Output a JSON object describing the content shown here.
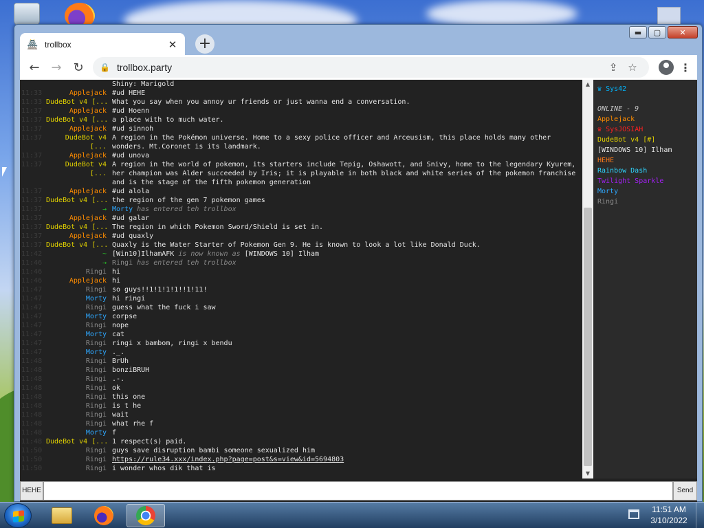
{
  "browser": {
    "tab_title": "trollbox",
    "tab_favicon": "🏯",
    "tab_close": "✕",
    "newtab": "+",
    "url": "trollbox.party",
    "back": "←",
    "forward": "→",
    "reload": "↻",
    "share": "⇪",
    "star": "☆",
    "menu": "⋮",
    "lock": "🔒"
  },
  "window_controls": {
    "minimize": "▬",
    "maximize": "▢",
    "close": "✕"
  },
  "colors": {
    "applejack": "#ff8c00",
    "dudebot": "#e0d000",
    "ringi": "#8a8a8a",
    "morty": "#2ea8ff",
    "system": "#29c429",
    "sys42": "#00b7ff",
    "sysjosiah": "#ff2020",
    "hehe": "#ff7a18",
    "rainbow": "#2ed6ff",
    "twilight": "#a020f0",
    "ilham": "#e6e6e6"
  },
  "chat": {
    "messages": [
      {
        "time": "",
        "nick": "",
        "nick_color": "#8a8a8a",
        "text": "Shiny: Marigold"
      },
      {
        "time": "11:33",
        "nick": "Applejack",
        "nick_color": "#ff8c00",
        "text": "#ud HEHE"
      },
      {
        "time": "11:33",
        "nick": "DudeBot v4 [...",
        "nick_color": "#e0d000",
        "text": "What you say when you annoy ur friends or just wanna end a conversation."
      },
      {
        "time": "11:37",
        "nick": "Applejack",
        "nick_color": "#ff8c00",
        "text": "#ud Hoenn"
      },
      {
        "time": "11:37",
        "nick": "DudeBot v4 [...",
        "nick_color": "#e0d000",
        "text": "a place with to much water."
      },
      {
        "time": "11:37",
        "nick": "Applejack",
        "nick_color": "#ff8c00",
        "text": "#ud sinnoh"
      },
      {
        "time": "11:37",
        "nick": "DudeBot v4 [...",
        "nick_color": "#e0d000",
        "text": "A region in the Pokémon universe. Home to a sexy police officer and Arceusism, this place holds many other wonders. Mt.Coronet is its landmark."
      },
      {
        "time": "11:37",
        "nick": "Applejack",
        "nick_color": "#ff8c00",
        "text": "#ud unova"
      },
      {
        "time": "11:37",
        "nick": "DudeBot v4 [...",
        "nick_color": "#e0d000",
        "text": "A region in the world of pokemon, its starters include Tepig, Oshawott, and Snivy, home to the legendary Kyurem, her champion was Alder succeeded by Iris; it is playable in both black and white series of the pokemon franchise and is the stage of the fifth pokemon generation"
      },
      {
        "time": "11:37",
        "nick": "Applejack",
        "nick_color": "#ff8c00",
        "text": "#ud alola"
      },
      {
        "time": "11:37",
        "nick": "DudeBot v4 [...",
        "nick_color": "#e0d000",
        "text": "the region of the gen 7 pokemon games"
      },
      {
        "time": "11:37",
        "nick": "→",
        "nick_color": "#29c429",
        "text": "",
        "event_user": "Morty",
        "event_user_color": "#2ea8ff",
        "event_text": " has entered teh trollbox"
      },
      {
        "time": "11:37",
        "nick": "Applejack",
        "nick_color": "#ff8c00",
        "text": "#ud galar"
      },
      {
        "time": "11:37",
        "nick": "DudeBot v4 [...",
        "nick_color": "#e0d000",
        "text": "The region in which Pokemon Sword/Shield is set in."
      },
      {
        "time": "11:37",
        "nick": "Applejack",
        "nick_color": "#ff8c00",
        "text": "#ud quaxly"
      },
      {
        "time": "11:37",
        "nick": "DudeBot v4 [...",
        "nick_color": "#e0d000",
        "text": "Quaxly is the Water Starter of Pokemon Gen 9. He is known to look a lot like Donald Duck."
      },
      {
        "time": "11:42",
        "nick": "~",
        "nick_color": "#29c429",
        "text": "",
        "event_user": "[Win10]IlhamAFK",
        "event_user_color": "#e6e6e6",
        "event_text": " is now known as ",
        "event_tail": "[WINDOWS 10] Ilham"
      },
      {
        "time": "11:46",
        "nick": "→",
        "nick_color": "#29c429",
        "text": "",
        "event_user": "Ringi",
        "event_user_color": "#8a8a8a",
        "event_text": " has entered teh trollbox"
      },
      {
        "time": "11:46",
        "nick": "Ringi",
        "nick_color": "#8a8a8a",
        "text": "hi"
      },
      {
        "time": "11:46",
        "nick": "Applejack",
        "nick_color": "#ff8c00",
        "text": "hi"
      },
      {
        "time": "11:47",
        "nick": "Ringi",
        "nick_color": "#8a8a8a",
        "text": "so guys!!1!1!1!1!!1!11!"
      },
      {
        "time": "11:47",
        "nick": "Morty",
        "nick_color": "#2ea8ff",
        "text": "hi ringi"
      },
      {
        "time": "11:47",
        "nick": "Ringi",
        "nick_color": "#8a8a8a",
        "text": "guess what the fuck i saw"
      },
      {
        "time": "11:47",
        "nick": "Morty",
        "nick_color": "#2ea8ff",
        "text": "corpse"
      },
      {
        "time": "11:47",
        "nick": "Ringi",
        "nick_color": "#8a8a8a",
        "text": "nope"
      },
      {
        "time": "11:47",
        "nick": "Morty",
        "nick_color": "#2ea8ff",
        "text": "cat"
      },
      {
        "time": "11:47",
        "nick": "Ringi",
        "nick_color": "#8a8a8a",
        "text": "ringi x bambom, ringi x bendu"
      },
      {
        "time": "11:47",
        "nick": "Morty",
        "nick_color": "#2ea8ff",
        "text": "._."
      },
      {
        "time": "11:48",
        "nick": "Ringi",
        "nick_color": "#8a8a8a",
        "text": "BrUh"
      },
      {
        "time": "11:48",
        "nick": "Ringi",
        "nick_color": "#8a8a8a",
        "text": "bonziBRUH"
      },
      {
        "time": "11:48",
        "nick": "Ringi",
        "nick_color": "#8a8a8a",
        "text": ".-."
      },
      {
        "time": "11:48",
        "nick": "Ringi",
        "nick_color": "#8a8a8a",
        "text": "ok"
      },
      {
        "time": "11:48",
        "nick": "Ringi",
        "nick_color": "#8a8a8a",
        "text": "this one"
      },
      {
        "time": "11:48",
        "nick": "Ringi",
        "nick_color": "#8a8a8a",
        "text": "is t he"
      },
      {
        "time": "11:48",
        "nick": "Ringi",
        "nick_color": "#8a8a8a",
        "text": "wait"
      },
      {
        "time": "11:48",
        "nick": "Ringi",
        "nick_color": "#8a8a8a",
        "text": "what rhe f"
      },
      {
        "time": "11:48",
        "nick": "Morty",
        "nick_color": "#2ea8ff",
        "text": "f"
      },
      {
        "time": "11:48",
        "nick": "DudeBot v4 [...",
        "nick_color": "#e0d000",
        "text": "1 respect(s) paid."
      },
      {
        "time": "11:50",
        "nick": "Ringi",
        "nick_color": "#8a8a8a",
        "text": "guys save disruption bambi someone sexualized him"
      },
      {
        "time": "11:50",
        "nick": "Ringi",
        "nick_color": "#8a8a8a",
        "text": "https://rule34.xxx/index.php?page=post&s=view&id=5694803",
        "link": true
      },
      {
        "time": "11:50",
        "nick": "Ringi",
        "nick_color": "#8a8a8a",
        "text": "i wonder whos dik that is"
      }
    ]
  },
  "users": {
    "top": [
      {
        "name": "Sys42",
        "color": "#00b7ff",
        "icon": "♛"
      }
    ],
    "online_label": "ONLINE - 9",
    "list": [
      {
        "name": "Applejack",
        "color": "#ff8c00",
        "icon": ""
      },
      {
        "name": "SysJOSIAH",
        "color": "#ff2020",
        "icon": "♛"
      },
      {
        "name": "DudeBot v4 [#]",
        "color": "#e0d000",
        "icon": ""
      },
      {
        "name": "[WINDOWS 10] Ilham",
        "color": "#e6e6e6",
        "icon": ""
      },
      {
        "name": "HEHE",
        "color": "#ff7a18",
        "icon": ""
      },
      {
        "name": "Rainbow Dash",
        "color": "#2ed6ff",
        "icon": ""
      },
      {
        "name": "Twilight Sparkle",
        "color": "#a020f0",
        "icon": ""
      },
      {
        "name": "Morty",
        "color": "#2ea8ff",
        "icon": ""
      },
      {
        "name": "Ringi",
        "color": "#8a8a8a",
        "icon": ""
      }
    ]
  },
  "input": {
    "nick_button": "HEHE",
    "value": "",
    "placeholder": "",
    "send_button": "Send"
  },
  "scrollbar": {
    "up": "▲",
    "down": "▼"
  },
  "taskbar": {
    "time": "11:51 AM",
    "date": "3/10/2022"
  }
}
